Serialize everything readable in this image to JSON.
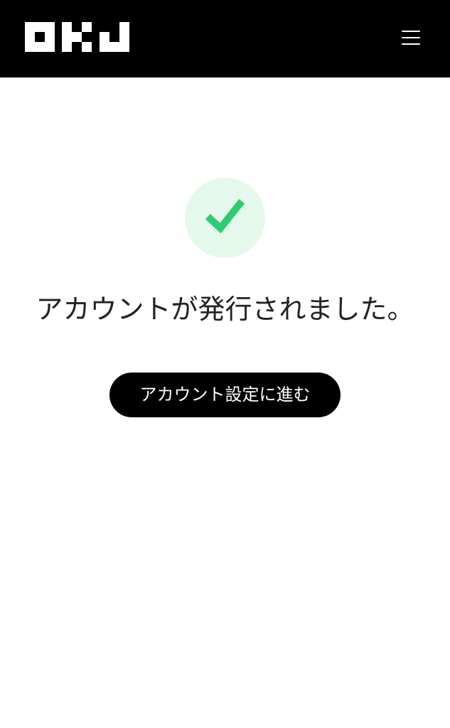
{
  "header": {
    "logo_text": "OKJ",
    "menu_icon": "hamburger-menu-icon"
  },
  "main": {
    "status_icon": "check-icon",
    "message": "アカウントが発行されました。",
    "cta_label": "アカウント設定に進む"
  },
  "colors": {
    "header_bg": "#000000",
    "check_circle_bg": "#e5f8ec",
    "check_green": "#2ecc71",
    "button_bg": "#000000",
    "button_text": "#ffffff"
  }
}
